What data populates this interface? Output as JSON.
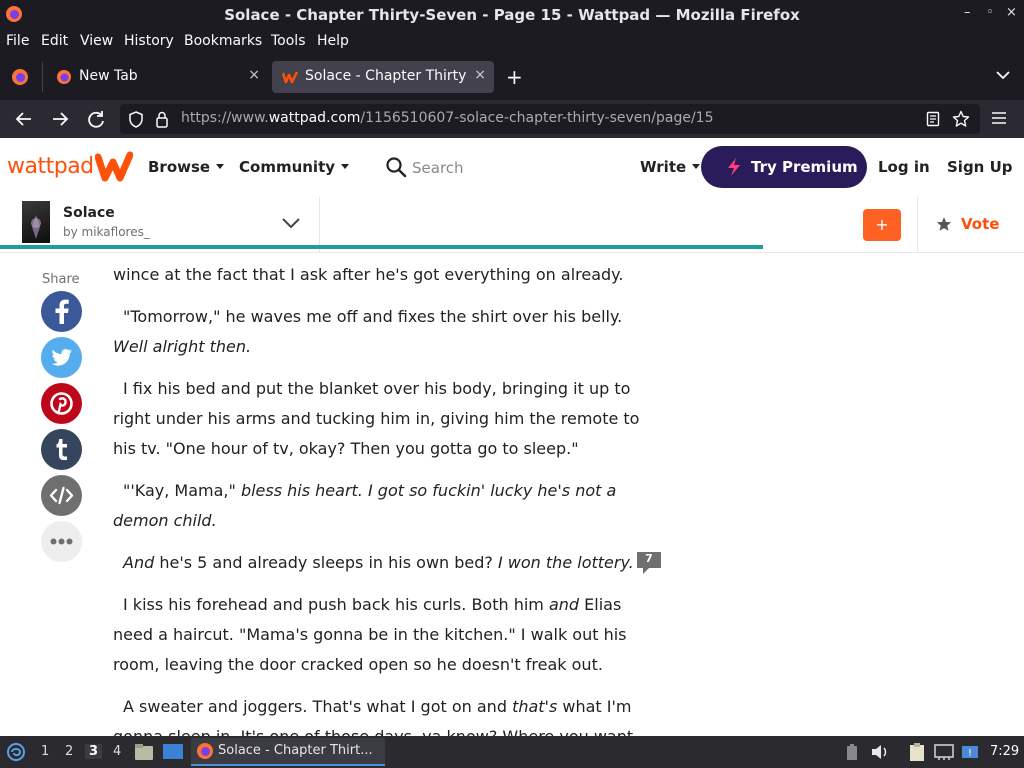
{
  "window": {
    "title": "Solace - Chapter Thirty-Seven - Page 15 - Wattpad — Mozilla Firefox",
    "controls": [
      "–",
      "◦",
      "×"
    ]
  },
  "menubar": {
    "items": [
      "File",
      "Edit",
      "View",
      "History",
      "Bookmarks",
      "Tools",
      "Help"
    ]
  },
  "tabs": [
    {
      "label": "New Tab",
      "close": "×"
    },
    {
      "label": "Solace - Chapter Thirty-Seven",
      "close": "×"
    }
  ],
  "navbar": {
    "url_prefix": "https://www.",
    "url_domain": "wattpad.com",
    "url_path": "/1156510607-solace-chapter-thirty-seven/page/15"
  },
  "header": {
    "logo": "wattpad",
    "browse": "Browse",
    "community": "Community",
    "search_placeholder": "Search",
    "write": "Write",
    "premium": "Try Premium",
    "login": "Log in",
    "signup": "Sign Up",
    "brand_color": "#ff500a",
    "premium_color": "#2a1c5b"
  },
  "story": {
    "title": "Solace",
    "author": "by mikaflores_",
    "add": "+",
    "vote": "Vote",
    "progress": 0.745
  },
  "share": {
    "label": "Share",
    "buttons": [
      "facebook",
      "twitter",
      "pinterest",
      "tumblr",
      "embed",
      "more"
    ]
  },
  "reading": {
    "p1": "wince at the fact that I ask after he's got everything on already.",
    "p2a": "\"Tomorrow,\" he waves me off and fixes the shirt over his belly. ",
    "p2b": "Well alright then.",
    "p3": "I fix his bed and put the blanket over his body, bringing it up to right under his arms and tucking him in, giving him the remote to his tv. \"One hour of tv, okay? Then you gotta go to sleep.\"",
    "p4a": "\"'Kay, Mama,\" ",
    "p4b": "bless his heart. I got so fuckin' lucky he's not a demon child.",
    "p5a": "And",
    "p5b": " he's 5 and already sleeps in his own bed? ",
    "p5c": "I won the lottery.",
    "p6a": "I kiss his forehead and push back his curls. Both him ",
    "p6b": "and",
    "p6c": " Elias need a haircut. \"Mama's gonna be in the kitchen.\" I walk out his room, leaving the door cracked open so he doesn't freak out.",
    "p7a": "A sweater and joggers. That's what I got on and ",
    "p7b": "that's",
    "p7c": " what I'm gonna sleep in. It's one of those days, ya know? Where you want",
    "comment_count": "7"
  },
  "taskbar": {
    "workspaces": [
      "1",
      "2",
      "3",
      "4"
    ],
    "active_workspace": "3",
    "task": "Solace - Chapter Thirt...",
    "clock": "7:29"
  }
}
